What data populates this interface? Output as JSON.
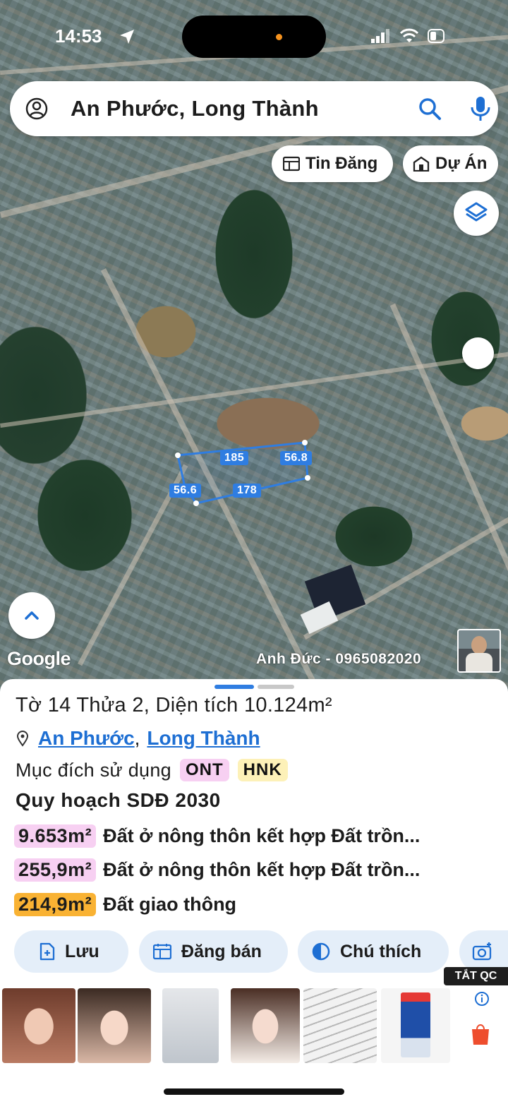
{
  "status_bar": {
    "time": "14:53"
  },
  "search": {
    "text": "An Phước, Long Thành"
  },
  "chips": {
    "listings": "Tin Đăng",
    "projects": "Dự Án"
  },
  "map": {
    "plot_edges": [
      "185",
      "56.8",
      "56.6",
      "178"
    ],
    "google_label": "Google",
    "watermark": "Anh Đức - 0965082020"
  },
  "sheet": {
    "title": "Tờ 14 Thửa 2, Diện tích 10.124m²",
    "location": {
      "ward": "An Phước",
      "separator": ",",
      "district": "Long Thành"
    },
    "purpose_label": "Mục đích sử dụng",
    "purpose_codes": [
      {
        "code": "ONT",
        "color": "#f7d0f2"
      },
      {
        "code": "HNK",
        "color": "#fdf1b8"
      }
    ],
    "plan_title": "Quy hoạch SDĐ 2030",
    "zones": [
      {
        "area": "9.653m²",
        "desc": "Đất ở nông thôn kết hợp Đất trồn...",
        "color": "#f7d0f2"
      },
      {
        "area": "255,9m²",
        "desc": "Đất ở nông thôn kết hợp Đất trồn...",
        "color": "#f7d0f2"
      },
      {
        "area": "214,9m²",
        "desc": "Đất giao thông",
        "color": "#f9b233"
      }
    ],
    "actions": {
      "save": "Lưu",
      "post": "Đăng bán",
      "legend": "Chú thích"
    }
  },
  "ads": {
    "hide_label": "TẮT QC"
  },
  "colors": {
    "accent": "#1e6fd3",
    "pager_active": "#2f7de1",
    "pager_inactive": "#c8c8c8",
    "action_bg": "#e4eef9"
  }
}
